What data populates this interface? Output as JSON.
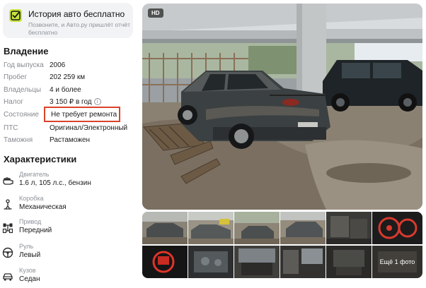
{
  "promo": {
    "title": "История авто бесплатно",
    "subtitle": "Позвоните, и Авто.ру пришлёт отчёт бесплатно",
    "icon": "check-square-icon",
    "accent_color": "#c8e63c"
  },
  "ownership": {
    "title": "Владение",
    "rows": [
      {
        "label": "Год выпуска",
        "value": "2006"
      },
      {
        "label": "Пробег",
        "value": "202 259 км"
      },
      {
        "label": "Владельцы",
        "value": "4 и более"
      },
      {
        "label": "Налог",
        "value": "3 150 ₽ в год"
      },
      {
        "label": "Состояние",
        "value": "Не требует ремонта"
      },
      {
        "label": "ПТС",
        "value": "Оригинал/Электронный"
      },
      {
        "label": "Таможня",
        "value": "Растаможен"
      }
    ],
    "tax_info_icon": "i",
    "highlight_color": "#d9442a"
  },
  "characteristics": {
    "title": "Характеристики",
    "items": [
      {
        "label": "Двигатель",
        "value": "1.6 л, 105 л.с., бензин",
        "icon": "engine-icon"
      },
      {
        "label": "Коробка",
        "value": "Механическая",
        "icon": "gearbox-icon"
      },
      {
        "label": "Привод",
        "value": "Передний",
        "icon": "drive-icon"
      },
      {
        "label": "Руль",
        "value": "Левый",
        "icon": "steering-wheel-icon"
      },
      {
        "label": "Кузов",
        "value": "Седан",
        "icon": "car-body-icon"
      }
    ]
  },
  "gallery": {
    "hd_badge": "HD",
    "more_photos": "Ещё 1 фото",
    "thumbnail_count": 12
  }
}
